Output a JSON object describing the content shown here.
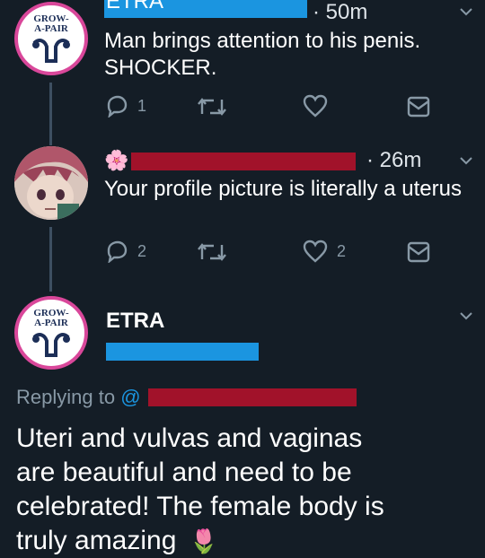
{
  "colors": {
    "background": "#141d26",
    "icon_gray": "#8899a6",
    "logo_pink": "#d9479a",
    "logo_navy": "#1c2e57",
    "redaction_blue": "#1b95e0",
    "redaction_red": "#a1122a",
    "link_blue": "#1b95e0"
  },
  "tweet1": {
    "avatar_text": [
      "GROW-",
      "A-PAIR"
    ],
    "handle_fragment": "ETRA",
    "time": "· 50m",
    "text_line1": "Man brings attention to his penis.",
    "text_line2": "SHOCKER.",
    "reply_count": "1",
    "like_count": "",
    "icons": [
      "reply-icon",
      "retweet-icon",
      "like-icon",
      "dm-icon",
      "chevron-down-icon"
    ]
  },
  "tweet2": {
    "badge_emoji": "🌸",
    "time": "· 26m",
    "text": "Your profile picture is literally a uterus",
    "reply_count": "2",
    "like_count": "2"
  },
  "tweet3": {
    "avatar_text": [
      "GROW-",
      "A-PAIR"
    ],
    "display_name": "ETRA",
    "replying_prefix": "Replying to ",
    "replying_at": "@",
    "text_lines": [
      "Uteri and vulvas and vaginas",
      "are beautiful and need to be",
      "celebrated! The female body is",
      "truly amazing"
    ],
    "emoji": "🌷"
  }
}
